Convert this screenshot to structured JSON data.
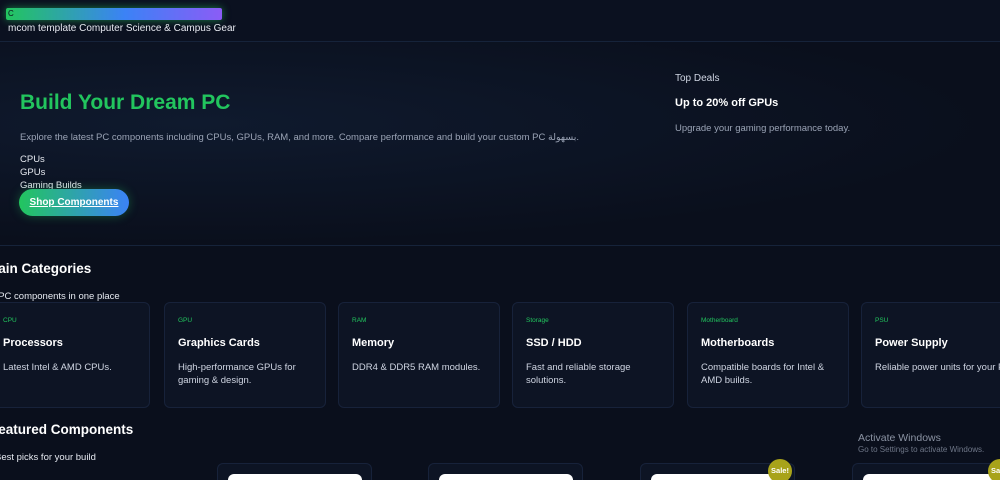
{
  "header": {
    "logo_text": "C",
    "brand": "mcom template Computer Science & Campus Gear"
  },
  "hero": {
    "title": "Build Your Dream PC",
    "description": "Explore the latest PC components including CPUs, GPUs, RAM, and more. Compare performance and build your custom PC بسهولة.",
    "list": [
      "CPUs",
      "GPUs",
      "Gaming Builds"
    ],
    "cta": "Shop Components"
  },
  "deals": {
    "label": "Top Deals",
    "title": "Up to 20% off GPUs",
    "description": "Upgrade your gaming performance today."
  },
  "categories": {
    "title": "Main Categories",
    "subtitle": "All PC components in one place",
    "items": [
      {
        "tag": "CPU",
        "name": "Processors",
        "desc": "Latest Intel & AMD CPUs."
      },
      {
        "tag": "GPU",
        "name": "Graphics Cards",
        "desc": "High-performance GPUs for gaming & design."
      },
      {
        "tag": "RAM",
        "name": "Memory",
        "desc": "DDR4 & DDR5 RAM modules."
      },
      {
        "tag": "Storage",
        "name": "SSD / HDD",
        "desc": "Fast and reliable storage solutions."
      },
      {
        "tag": "Motherboard",
        "name": "Motherboards",
        "desc": "Compatible boards for Intel & AMD builds."
      },
      {
        "tag": "PSU",
        "name": "Power Supply",
        "desc": "Reliable power units for your PC."
      }
    ]
  },
  "featured": {
    "title": "Featured Components",
    "subtitle": "Best picks for your build",
    "sale_label": "Sale!"
  },
  "watermark": {
    "title": "Activate Windows",
    "subtitle": "Go to Settings to activate Windows."
  },
  "colors": {
    "accent_green": "#22c55e",
    "accent_blue": "#3b82f6",
    "background": "#0a0f1c",
    "sale_badge": "#a8a31a"
  }
}
